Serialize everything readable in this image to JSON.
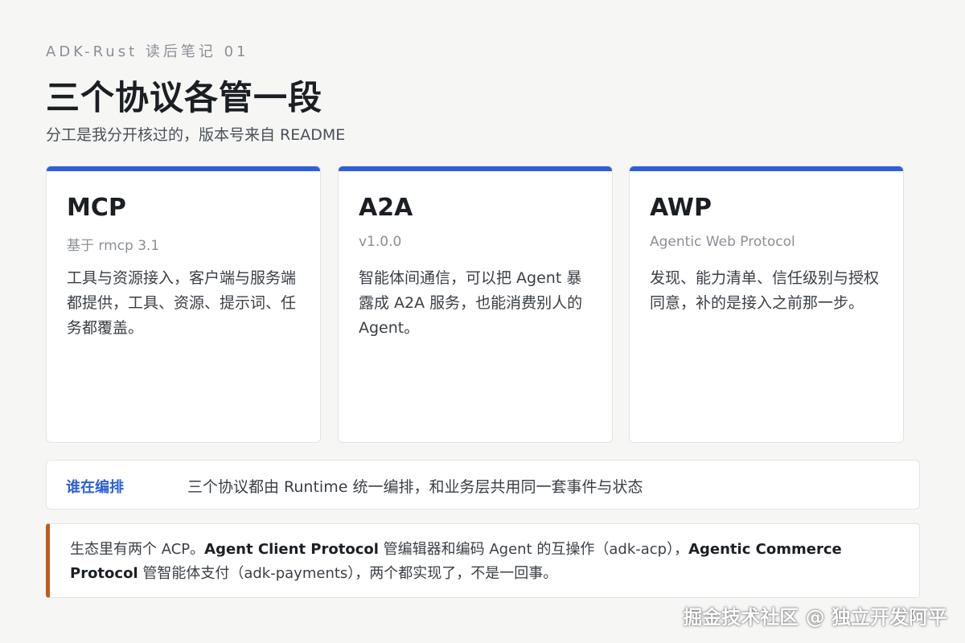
{
  "header": {
    "eyebrow": "ADK-Rust 读后笔记 01",
    "title": "三个协议各管一段",
    "subtitle": "分工是我分开核过的，版本号来自 README"
  },
  "cards": [
    {
      "name": "MCP",
      "meta": "基于 rmcp 3.1",
      "desc": "工具与资源接入，客户端与服务端都提供，工具、资源、提示词、任务都覆盖。"
    },
    {
      "name": "A2A",
      "meta": "v1.0.0",
      "desc": "智能体间通信，可以把 Agent 暴露成 A2A 服务，也能消费别人的 Agent。"
    },
    {
      "name": "AWP",
      "meta": "Agentic Web Protocol",
      "desc": "发现、能力清单、信任级别与授权同意，补的是接入之前那一步。"
    }
  ],
  "orchestration": {
    "label": "谁在编排",
    "text": "三个协议都由 Runtime 统一编排，和业务层共用同一套事件与状态"
  },
  "note": {
    "part1": "生态里有两个 ACP。",
    "bold1": "Agent Client Protocol",
    "part2": " 管编辑器和编码 Agent 的互操作（adk-acp），",
    "bold2": "Agentic Commerce Protocol",
    "part3": " 管智能体支付（adk-payments），两个都实现了，不是一回事。"
  },
  "watermark": "掘金技术社区 @ 独立开发阿平",
  "colors": {
    "accent_blue": "#2d5fd6",
    "note_bar": "#c05a1c",
    "background": "#f6f6f5"
  }
}
